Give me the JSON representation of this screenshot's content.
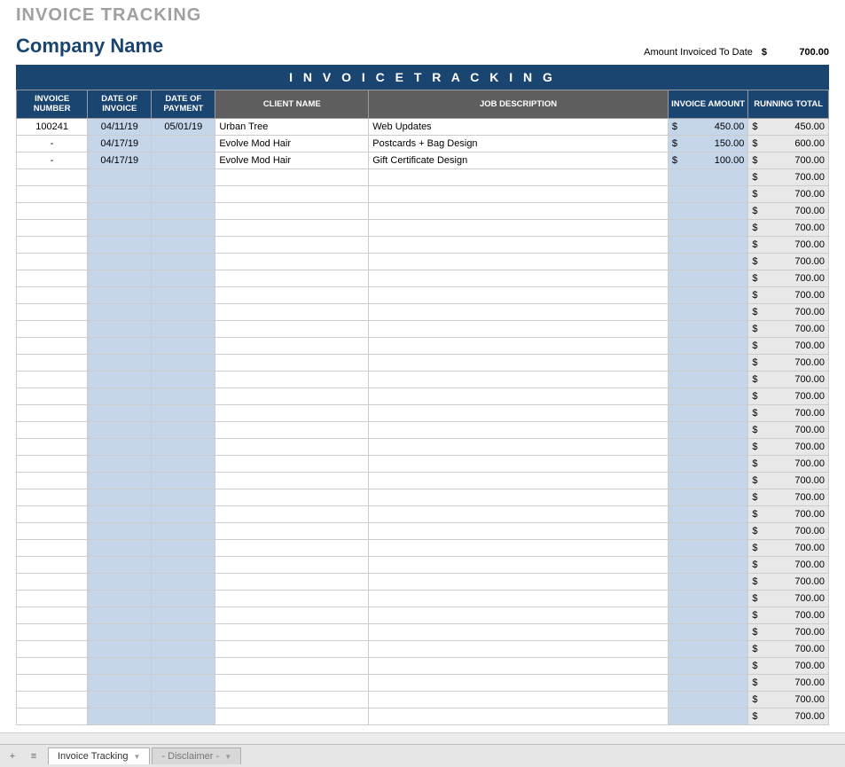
{
  "page_title": "INVOICE TRACKING",
  "company_name": "Company Name",
  "amount_invoiced": {
    "label": "Amount Invoiced To Date",
    "currency": "$",
    "value": "700.00"
  },
  "banner": "I N V O I C E   T R A C K I N G",
  "columns": {
    "invoice_number": "INVOICE NUMBER",
    "date_of_invoice": "DATE OF INVOICE",
    "date_of_payment": "DATE OF PAYMENT",
    "client_name": "CLIENT NAME",
    "job_description": "JOB DESCRIPTION",
    "invoice_amount": "INVOICE AMOUNT",
    "running_total": "RUNNING TOTAL"
  },
  "rows": [
    {
      "invoice_number": "100241",
      "date_of_invoice": "04/11/19",
      "date_of_payment": "05/01/19",
      "client": "Urban Tree",
      "job": "Web Updates",
      "amount": "450.00",
      "running": "450.00"
    },
    {
      "invoice_number": "-",
      "date_of_invoice": "04/17/19",
      "date_of_payment": "",
      "client": "Evolve Mod Hair",
      "job": "Postcards + Bag Design",
      "amount": "150.00",
      "running": "600.00"
    },
    {
      "invoice_number": "-",
      "date_of_invoice": "04/17/19",
      "date_of_payment": "",
      "client": "Evolve Mod Hair",
      "job": "Gift Certificate Design",
      "amount": "100.00",
      "running": "700.00"
    },
    {
      "invoice_number": "",
      "date_of_invoice": "",
      "date_of_payment": "",
      "client": "",
      "job": "",
      "amount": "",
      "running": "700.00"
    },
    {
      "invoice_number": "",
      "date_of_invoice": "",
      "date_of_payment": "",
      "client": "",
      "job": "",
      "amount": "",
      "running": "700.00"
    },
    {
      "invoice_number": "",
      "date_of_invoice": "",
      "date_of_payment": "",
      "client": "",
      "job": "",
      "amount": "",
      "running": "700.00"
    },
    {
      "invoice_number": "",
      "date_of_invoice": "",
      "date_of_payment": "",
      "client": "",
      "job": "",
      "amount": "",
      "running": "700.00"
    },
    {
      "invoice_number": "",
      "date_of_invoice": "",
      "date_of_payment": "",
      "client": "",
      "job": "",
      "amount": "",
      "running": "700.00"
    },
    {
      "invoice_number": "",
      "date_of_invoice": "",
      "date_of_payment": "",
      "client": "",
      "job": "",
      "amount": "",
      "running": "700.00"
    },
    {
      "invoice_number": "",
      "date_of_invoice": "",
      "date_of_payment": "",
      "client": "",
      "job": "",
      "amount": "",
      "running": "700.00"
    },
    {
      "invoice_number": "",
      "date_of_invoice": "",
      "date_of_payment": "",
      "client": "",
      "job": "",
      "amount": "",
      "running": "700.00"
    },
    {
      "invoice_number": "",
      "date_of_invoice": "",
      "date_of_payment": "",
      "client": "",
      "job": "",
      "amount": "",
      "running": "700.00"
    },
    {
      "invoice_number": "",
      "date_of_invoice": "",
      "date_of_payment": "",
      "client": "",
      "job": "",
      "amount": "",
      "running": "700.00"
    },
    {
      "invoice_number": "",
      "date_of_invoice": "",
      "date_of_payment": "",
      "client": "",
      "job": "",
      "amount": "",
      "running": "700.00"
    },
    {
      "invoice_number": "",
      "date_of_invoice": "",
      "date_of_payment": "",
      "client": "",
      "job": "",
      "amount": "",
      "running": "700.00"
    },
    {
      "invoice_number": "",
      "date_of_invoice": "",
      "date_of_payment": "",
      "client": "",
      "job": "",
      "amount": "",
      "running": "700.00"
    },
    {
      "invoice_number": "",
      "date_of_invoice": "",
      "date_of_payment": "",
      "client": "",
      "job": "",
      "amount": "",
      "running": "700.00"
    },
    {
      "invoice_number": "",
      "date_of_invoice": "",
      "date_of_payment": "",
      "client": "",
      "job": "",
      "amount": "",
      "running": "700.00"
    },
    {
      "invoice_number": "",
      "date_of_invoice": "",
      "date_of_payment": "",
      "client": "",
      "job": "",
      "amount": "",
      "running": "700.00"
    },
    {
      "invoice_number": "",
      "date_of_invoice": "",
      "date_of_payment": "",
      "client": "",
      "job": "",
      "amount": "",
      "running": "700.00"
    },
    {
      "invoice_number": "",
      "date_of_invoice": "",
      "date_of_payment": "",
      "client": "",
      "job": "",
      "amount": "",
      "running": "700.00"
    },
    {
      "invoice_number": "",
      "date_of_invoice": "",
      "date_of_payment": "",
      "client": "",
      "job": "",
      "amount": "",
      "running": "700.00"
    },
    {
      "invoice_number": "",
      "date_of_invoice": "",
      "date_of_payment": "",
      "client": "",
      "job": "",
      "amount": "",
      "running": "700.00"
    },
    {
      "invoice_number": "",
      "date_of_invoice": "",
      "date_of_payment": "",
      "client": "",
      "job": "",
      "amount": "",
      "running": "700.00"
    },
    {
      "invoice_number": "",
      "date_of_invoice": "",
      "date_of_payment": "",
      "client": "",
      "job": "",
      "amount": "",
      "running": "700.00"
    },
    {
      "invoice_number": "",
      "date_of_invoice": "",
      "date_of_payment": "",
      "client": "",
      "job": "",
      "amount": "",
      "running": "700.00"
    },
    {
      "invoice_number": "",
      "date_of_invoice": "",
      "date_of_payment": "",
      "client": "",
      "job": "",
      "amount": "",
      "running": "700.00"
    },
    {
      "invoice_number": "",
      "date_of_invoice": "",
      "date_of_payment": "",
      "client": "",
      "job": "",
      "amount": "",
      "running": "700.00"
    },
    {
      "invoice_number": "",
      "date_of_invoice": "",
      "date_of_payment": "",
      "client": "",
      "job": "",
      "amount": "",
      "running": "700.00"
    },
    {
      "invoice_number": "",
      "date_of_invoice": "",
      "date_of_payment": "",
      "client": "",
      "job": "",
      "amount": "",
      "running": "700.00"
    },
    {
      "invoice_number": "",
      "date_of_invoice": "",
      "date_of_payment": "",
      "client": "",
      "job": "",
      "amount": "",
      "running": "700.00"
    },
    {
      "invoice_number": "",
      "date_of_invoice": "",
      "date_of_payment": "",
      "client": "",
      "job": "",
      "amount": "",
      "running": "700.00"
    },
    {
      "invoice_number": "",
      "date_of_invoice": "",
      "date_of_payment": "",
      "client": "",
      "job": "",
      "amount": "",
      "running": "700.00"
    },
    {
      "invoice_number": "",
      "date_of_invoice": "",
      "date_of_payment": "",
      "client": "",
      "job": "",
      "amount": "",
      "running": "700.00"
    },
    {
      "invoice_number": "",
      "date_of_invoice": "",
      "date_of_payment": "",
      "client": "",
      "job": "",
      "amount": "",
      "running": "700.00"
    },
    {
      "invoice_number": "",
      "date_of_invoice": "",
      "date_of_payment": "",
      "client": "",
      "job": "",
      "amount": "",
      "running": "700.00"
    }
  ],
  "tabs": [
    {
      "label": "Invoice Tracking",
      "active": true
    },
    {
      "label": "- Disclaimer -",
      "active": false
    }
  ],
  "currency_symbol": "$"
}
